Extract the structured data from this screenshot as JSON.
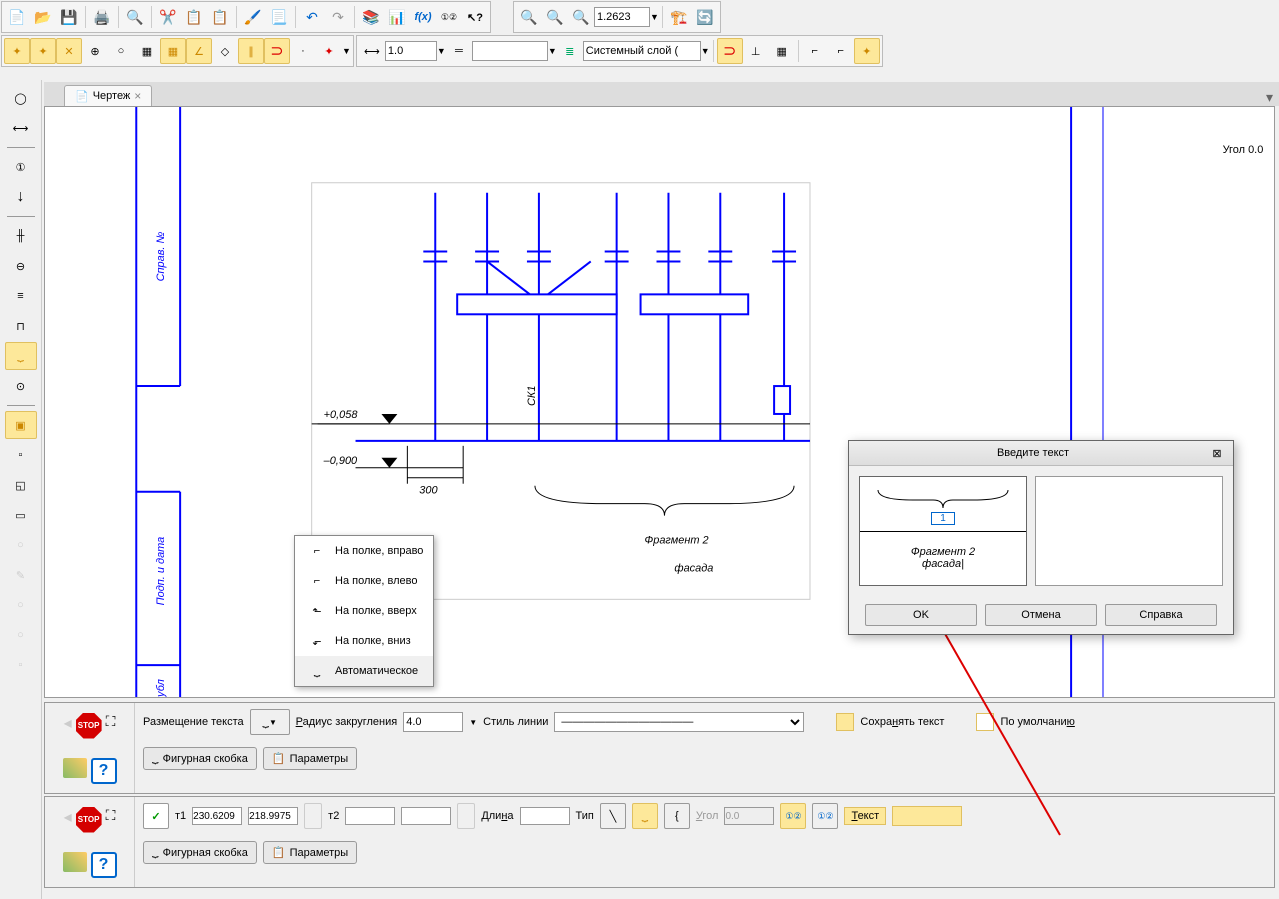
{
  "toolbar": {
    "zoom_value": "1.2623",
    "lineweight": "1.0",
    "layer": "Системный слой ("
  },
  "tab": {
    "name": "Чертеж"
  },
  "canvas": {
    "angle_label": "Угол 0.0",
    "sidebar_label_top": "Справ. №",
    "sidebar_label_bottom": "Подп. и дата",
    "sidebar_label_corner": "убл",
    "level1": "+0,058",
    "level2": "–0,900",
    "dim": "300",
    "axis_label": "СК1",
    "frag_line1": "Фрагмент 2",
    "frag_line2": "фасада"
  },
  "dropdown": {
    "items": [
      "На полке, вправо",
      "На полке, влево",
      "На полке, вверх",
      "На полке, вниз",
      "Автоматическое"
    ]
  },
  "dialog": {
    "title": "Введите текст",
    "preview_num": "1",
    "preview_l1": "Фрагмент 2",
    "preview_l2": "фасада|",
    "ok": "OK",
    "cancel": "Отмена",
    "help": "Справка"
  },
  "panel1": {
    "label_placement": "Размещение текста",
    "label_radius": "Радиус закругления",
    "radius_val": "4.0",
    "label_style": "Стиль линии",
    "save_text": "Сохранять текст",
    "default": "По умолчанию",
    "tab1": "Фигурная скобка",
    "tab2": "Параметры"
  },
  "panel2": {
    "t1_label": "т1",
    "t1_x": "230.6209",
    "t1_y": "218.9975",
    "t2_label": "т2",
    "len_label": "Длина",
    "type_label": "Тип",
    "angle_label": "Угол",
    "angle_val": "0.0",
    "text_label": "Текст",
    "tab1": "Фигурная скобка",
    "tab2": "Параметры"
  }
}
